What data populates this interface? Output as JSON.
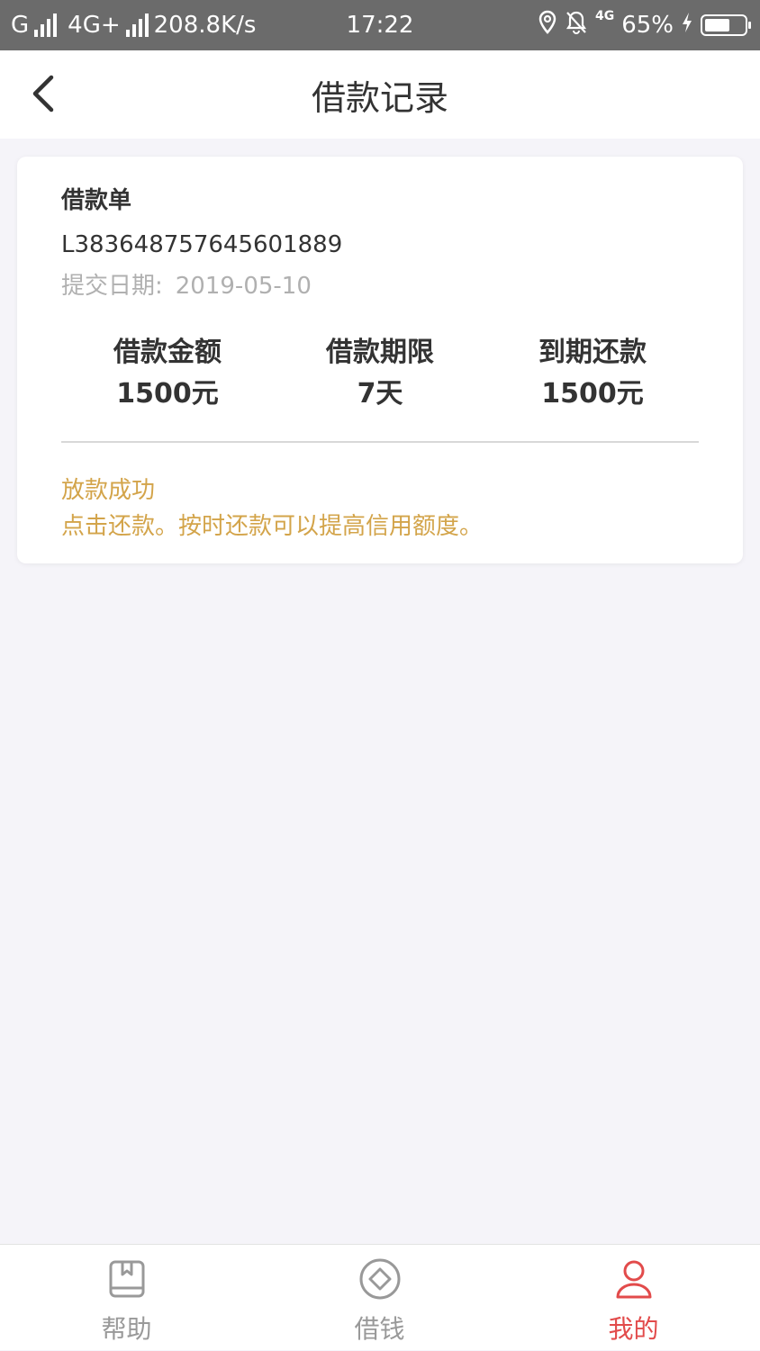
{
  "status_bar": {
    "carrier1": "G",
    "carrier2": "4G+",
    "speed": "208.8K/s",
    "time": "17:22",
    "network_small": "4G",
    "battery": "65%"
  },
  "nav": {
    "title": "借款记录"
  },
  "loan_card": {
    "title": "借款单",
    "order_no": "L383648757645601889",
    "submit_date_label": "提交日期:",
    "submit_date": "2019-05-10",
    "stats": [
      {
        "label": "借款金额",
        "value": "1500元"
      },
      {
        "label": "借款期限",
        "value": "7天"
      },
      {
        "label": "到期还款",
        "value": "1500元"
      }
    ],
    "status": "放款成功",
    "tip": "点击还款。按时还款可以提高信用额度。"
  },
  "tabbar": {
    "tabs": [
      {
        "label": "帮助",
        "icon": "book-icon"
      },
      {
        "label": "借钱",
        "icon": "diamond-icon"
      },
      {
        "label": "我的",
        "icon": "user-icon"
      }
    ],
    "active_index": 2
  },
  "colors": {
    "accent": "#e24b4b",
    "status": "#d3a44a",
    "background": "#f5f4f9"
  }
}
